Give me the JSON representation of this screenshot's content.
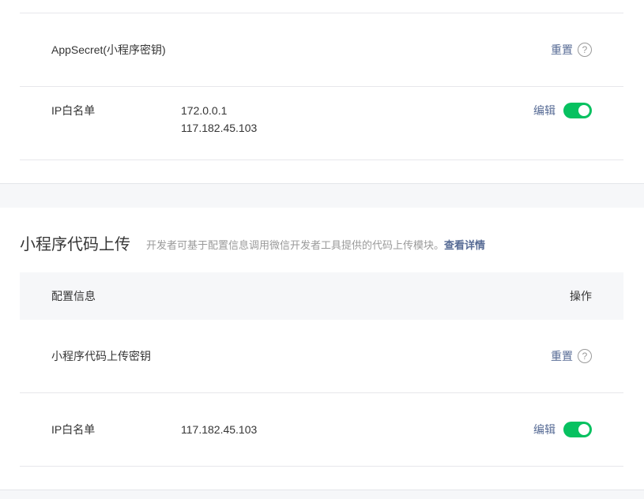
{
  "secret_table": {
    "rows": [
      {
        "label": "AppSecret(小程序密钥)",
        "action": "重置",
        "help": "?"
      },
      {
        "label": "IP白名单",
        "values": [
          "172.0.0.1",
          "117.182.45.103"
        ],
        "action": "编辑",
        "toggle_on": true
      }
    ]
  },
  "upload_section": {
    "title": "小程序代码上传",
    "desc": "开发者可基于配置信息调用微信开发者工具提供的代码上传模块。",
    "more_link": "查看详情",
    "header": {
      "col_left": "配置信息",
      "col_right": "操作"
    },
    "rows": [
      {
        "label": "小程序代码上传密钥",
        "action": "重置",
        "help": "?"
      },
      {
        "label": "IP白名单",
        "values": [
          "117.182.45.103"
        ],
        "action": "编辑",
        "toggle_on": true
      }
    ]
  },
  "colors": {
    "accent_link": "#576b95",
    "toggle_on": "#07c160",
    "page_bg": "#f6f7f9"
  }
}
